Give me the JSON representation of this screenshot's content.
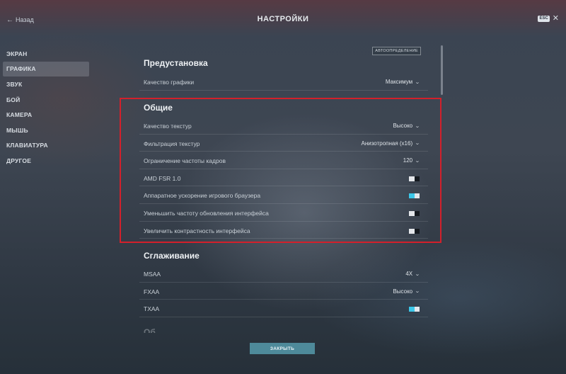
{
  "header": {
    "back_label": "Назад",
    "title": "НАСТРОЙКИ",
    "esc_label": "ESC",
    "close_icon": "close-icon",
    "back_icon": "arrow-left-icon"
  },
  "sidebar": {
    "items": [
      {
        "label": "ЭКРАН"
      },
      {
        "label": "ГРАФИКА",
        "active": true
      },
      {
        "label": "ЗВУК"
      },
      {
        "label": "БОЙ"
      },
      {
        "label": "КАМЕРА"
      },
      {
        "label": "МЫШЬ"
      },
      {
        "label": "КЛАВИАТУРА"
      },
      {
        "label": "ДРУГОЕ"
      }
    ]
  },
  "auto_detect_label": "АВТООПРЕДЕЛЕНИЕ",
  "sections": {
    "preset": {
      "title": "Предустановка",
      "rows": [
        {
          "label": "Качество графики",
          "value": "Максимум"
        }
      ]
    },
    "general": {
      "title": "Общие",
      "rows": [
        {
          "label": "Качество текстур",
          "value": "Высоко"
        },
        {
          "label": "Фильтрация текстур",
          "value": "Анизотропная (x16)"
        },
        {
          "label": "Ограничение частоты кадров",
          "value": "120"
        },
        {
          "label": "AMD FSR 1.0",
          "toggle": false
        },
        {
          "label": "Аппаратное ускорение игрового браузера",
          "toggle": true
        },
        {
          "label": "Уменьшить частоту обновления интерфейса",
          "toggle": false
        },
        {
          "label": "Увеличить контрастность интерфейса",
          "toggle": false
        }
      ]
    },
    "antialiasing": {
      "title": "Сглаживание",
      "rows": [
        {
          "label": "MSAA",
          "value": "4X"
        },
        {
          "label": "FXAA",
          "value": "Высоко"
        },
        {
          "label": "TXAA",
          "toggle": true
        }
      ]
    },
    "next_partial_title": "Об"
  },
  "footer": {
    "close_label": "ЗАКРЫТЬ"
  },
  "colors": {
    "accent": "#3cc7e8",
    "highlight_border": "#d3202b",
    "close_button": "#4e8a9a"
  }
}
